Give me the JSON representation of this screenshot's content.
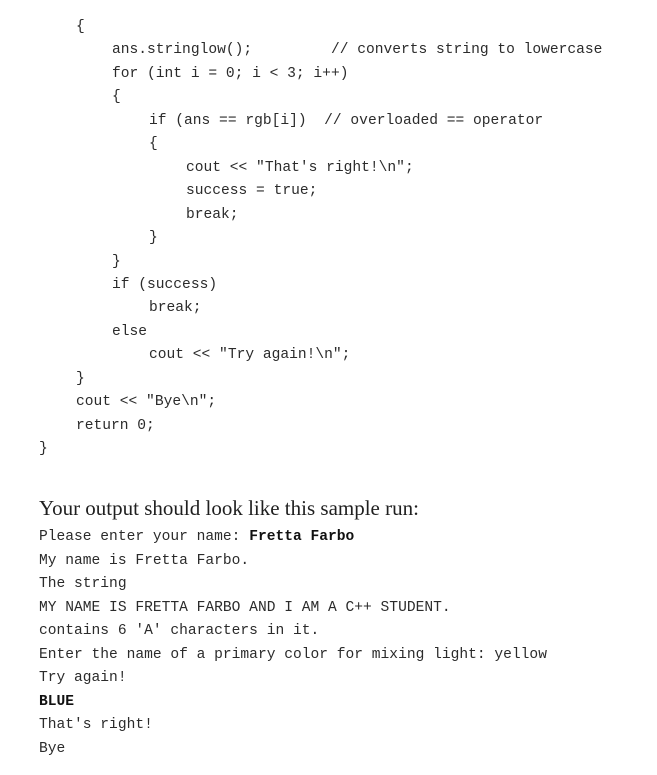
{
  "code": {
    "lines": [
      {
        "indent": 76,
        "text": "{"
      },
      {
        "indent": 112,
        "text": "ans.stringlow();         // converts string to lowercase"
      },
      {
        "indent": 112,
        "text": "for (int i = 0; i < 3; i++)"
      },
      {
        "indent": 112,
        "text": "{"
      },
      {
        "indent": 149,
        "text": "if (ans == rgb[i])  // overloaded == operator"
      },
      {
        "indent": 149,
        "text": "{"
      },
      {
        "indent": 186,
        "text": "cout << \"That's right!\\n\";"
      },
      {
        "indent": 186,
        "text": "success = true;"
      },
      {
        "indent": 186,
        "text": "break;"
      },
      {
        "indent": 149,
        "text": "}"
      },
      {
        "indent": 112,
        "text": "}"
      },
      {
        "indent": 112,
        "text": "if (success)"
      },
      {
        "indent": 149,
        "text": "break;"
      },
      {
        "indent": 112,
        "text": "else"
      },
      {
        "indent": 149,
        "text": "cout << \"Try again!\\n\";"
      },
      {
        "indent": 76,
        "text": "}"
      },
      {
        "indent": 76,
        "text": "cout << \"Bye\\n\";"
      },
      {
        "indent": 76,
        "text": "return 0;"
      },
      {
        "indent": 39,
        "text": "}"
      }
    ]
  },
  "sample_heading": "Your output should look like this sample run:",
  "sample_run": {
    "prompt_name": "Please enter your name: ",
    "user_name": "Fretta Farbo",
    "line_my_name": "My name is Fretta Farbo.",
    "line_the_string": "The string",
    "line_upper": "MY NAME IS FRETTA FARBO AND I AM A C++ STUDENT.",
    "line_contains": "contains 6 'A' characters in it.",
    "line_color_prompt": "Enter the name of a primary color for mixing light: yellow",
    "line_try_again": "Try again!",
    "user_blue": "BLUE",
    "line_thats_right": "That's right!",
    "line_bye": "Bye"
  }
}
